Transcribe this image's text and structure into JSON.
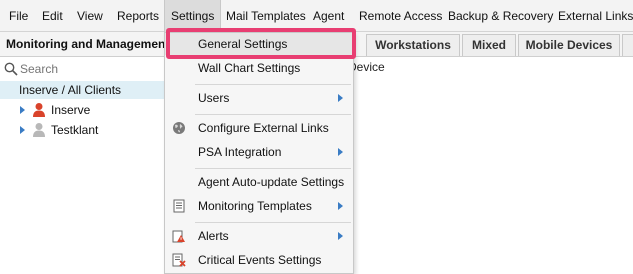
{
  "menubar": {
    "items": [
      "File",
      "Edit",
      "View",
      "Reports",
      "Settings",
      "Mail Templates",
      "Agent",
      "Remote Access",
      "Backup & Recovery",
      "External Links"
    ]
  },
  "tabstrip": {
    "panel_title": "Monitoring and Management",
    "tabs": [
      "Workstations",
      "Mixed",
      "Mobile Devices"
    ]
  },
  "left_panel": {
    "search_placeholder": "Search",
    "tree_root": "Inserve / All Clients",
    "clients": [
      "Inserve",
      "Testklant"
    ]
  },
  "main": {
    "device_text": "Device"
  },
  "settings_menu": {
    "items": [
      {
        "label": "General Settings",
        "submenu": false,
        "icon": null
      },
      {
        "label": "Wall Chart Settings",
        "submenu": false,
        "icon": null
      },
      {
        "label": "Users",
        "submenu": true,
        "icon": null
      },
      {
        "label": "Configure External Links",
        "submenu": false,
        "icon": "globe-icon"
      },
      {
        "label": "PSA Integration",
        "submenu": true,
        "icon": null
      },
      {
        "label": "Agent Auto-update Settings",
        "submenu": false,
        "icon": null
      },
      {
        "label": "Monitoring Templates",
        "submenu": true,
        "icon": "template-icon"
      },
      {
        "label": "Alerts",
        "submenu": true,
        "icon": "alert-icon"
      },
      {
        "label": "Critical Events Settings",
        "submenu": false,
        "icon": "critical-events-icon"
      }
    ]
  },
  "colors": {
    "highlight_border": "#e83e72",
    "accent_blue": "#3a7cc4",
    "tree_selected_bg": "#dfeff6"
  }
}
